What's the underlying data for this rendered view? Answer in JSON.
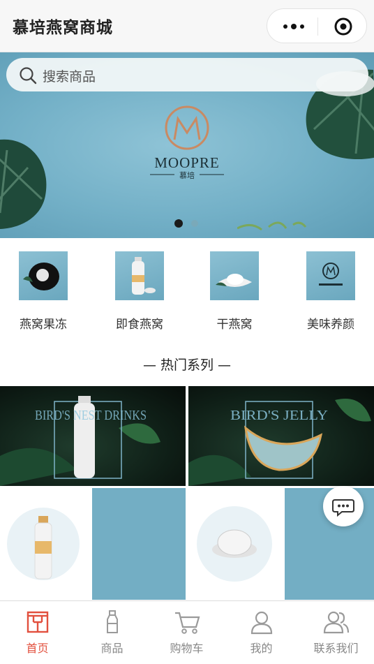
{
  "navbar": {
    "title": "慕培燕窝商城",
    "more_icon": "more-dots-icon",
    "close_icon": "target-close-icon"
  },
  "banner": {
    "search_placeholder": "搜索商品",
    "brand_name": "MOOPRE",
    "brand_chinese": "慕培",
    "slide_count": 2,
    "active_slide": 1
  },
  "categories": [
    {
      "label": "燕窝果冻"
    },
    {
      "label": "即食燕窝"
    },
    {
      "label": "干燕窝"
    },
    {
      "label": "美味养颜"
    }
  ],
  "section": {
    "title": "— 热门系列 —"
  },
  "products": [
    {
      "headline": "BIRD'S NEST DRINKS"
    },
    {
      "headline": "BIRD'S JELLY"
    }
  ],
  "tabbar": {
    "items": [
      {
        "label": "首页",
        "icon": "home-icon"
      },
      {
        "label": "商品",
        "icon": "bottle-icon"
      },
      {
        "label": "购物车",
        "icon": "cart-icon"
      },
      {
        "label": "我的",
        "icon": "user-icon"
      },
      {
        "label": "联系我们",
        "icon": "contacts-icon"
      }
    ],
    "active_index": 0
  },
  "colors": {
    "accent": "#e2503e",
    "banner_blue": "#73b0c7",
    "tab_inactive": "#888888"
  }
}
